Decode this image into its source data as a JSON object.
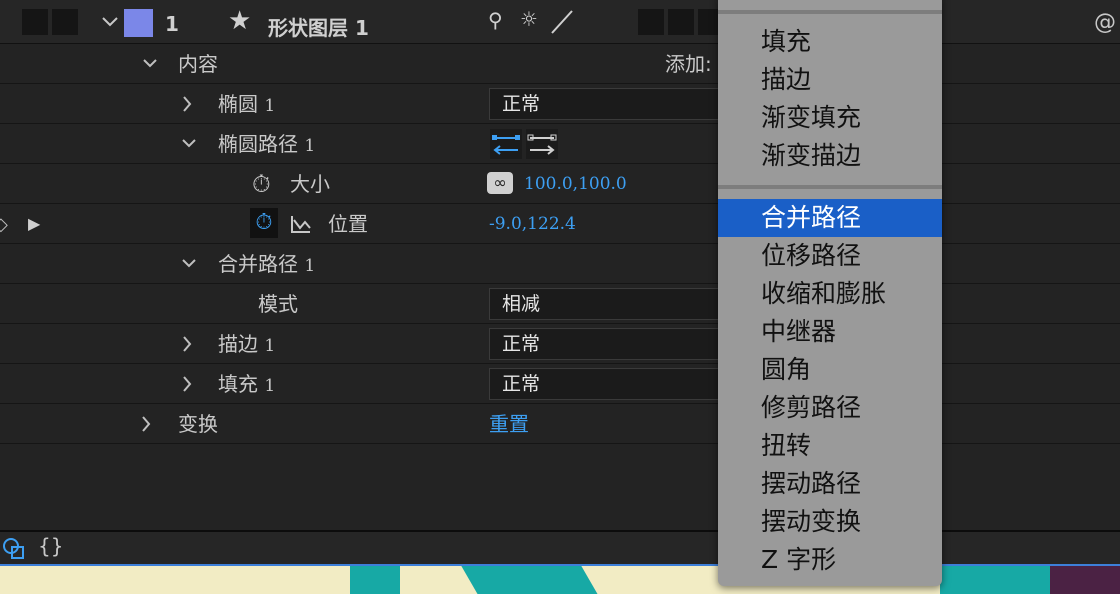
{
  "header": {
    "layer_number": "1",
    "layer_name": "形状图层 1",
    "label_color": "#7b87e8"
  },
  "rows": {
    "contents": {
      "label": "内容",
      "add_label": "添加:"
    },
    "ellipse": {
      "label": "椭圆",
      "index": "1",
      "blend_mode": "正常"
    },
    "ellipse_path": {
      "label": "椭圆路径",
      "index": "1"
    },
    "size": {
      "label": "大小",
      "value": "100.0,100.0"
    },
    "position": {
      "label": "位置",
      "value": "-9.0,122.4"
    },
    "merge_paths": {
      "label": "合并路径",
      "index": "1"
    },
    "mode": {
      "label": "模式",
      "value": "相减"
    },
    "stroke": {
      "label": "描边",
      "index": "1",
      "blend_mode": "正常"
    },
    "fill": {
      "label": "填充",
      "index": "1",
      "blend_mode": "正常"
    },
    "transform": {
      "label": "变换",
      "reset": "重置"
    }
  },
  "menu": {
    "items_top": [
      "填充",
      "描边",
      "渐变填充",
      "渐变描边"
    ],
    "items_bottom": [
      "合并路径",
      "位移路径",
      "收缩和膨胀",
      "中继器",
      "圆角",
      "修剪路径",
      "扭转",
      "摆动路径",
      "摆动变换",
      "Z 字形"
    ],
    "selected": "合并路径",
    "highlight_color": "#1a5fc7"
  }
}
